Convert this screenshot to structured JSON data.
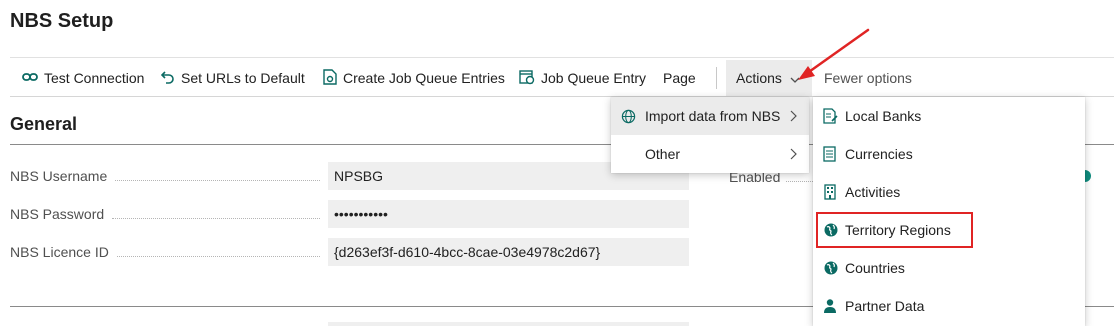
{
  "page": {
    "title": "NBS Setup"
  },
  "toolbar": {
    "test_connection": "Test Connection",
    "set_urls": "Set URLs to Default",
    "create_job_queue": "Create Job Queue Entries",
    "job_queue_entry": "Job Queue Entry",
    "page": "Page",
    "actions": "Actions",
    "fewer_options": "Fewer options"
  },
  "general": {
    "title": "General",
    "fields": [
      {
        "label": "NBS Username",
        "value": "NPSBG"
      },
      {
        "label": "NBS Password",
        "value": "•••••••••••"
      },
      {
        "label": "NBS Licence ID",
        "value": "{d263ef3f-d610-4bcc-8cae-03e4978c2d67}"
      }
    ],
    "right_label": "Enabled"
  },
  "menu_l1": {
    "items": [
      {
        "label": "Import data from NBS",
        "icon": "globe-icon"
      },
      {
        "label": "Other"
      }
    ]
  },
  "menu_l2": {
    "items": [
      {
        "label": "Local Banks",
        "icon": "document-edit-icon"
      },
      {
        "label": "Currencies",
        "icon": "document-list-icon"
      },
      {
        "label": "Activities",
        "icon": "building-icon"
      },
      {
        "label": "Territory Regions",
        "icon": "globe-icon"
      },
      {
        "label": "Countries",
        "icon": "globe-icon"
      },
      {
        "label": "Partner Data",
        "icon": "person-icon"
      }
    ]
  },
  "colors": {
    "accent": "#0f8c7e",
    "annotation": "#e02424",
    "icon_teal": "#0b6a63"
  }
}
